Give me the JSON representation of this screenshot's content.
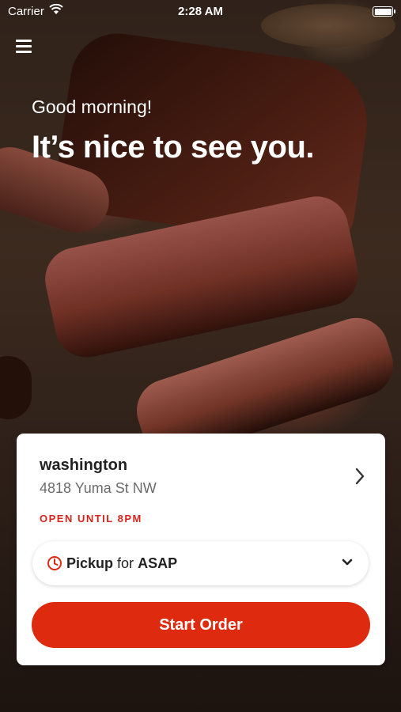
{
  "status_bar": {
    "carrier": "Carrier",
    "time": "2:28 AM"
  },
  "hero": {
    "greeting": "Good morning!",
    "headline": "It’s nice to see you."
  },
  "location": {
    "name": "washington",
    "address": "4818 Yuma St NW",
    "status": "OPEN UNTIL 8PM"
  },
  "order_mode": {
    "type": "Pickup",
    "connector": "for",
    "time": "ASAP"
  },
  "start_order_label": "Start Order",
  "colors": {
    "accent": "#de2a0f",
    "status_red": "#d9231b"
  },
  "icons": [
    "menu-icon",
    "wifi-icon",
    "battery-icon",
    "chevron-right-icon",
    "clock-icon",
    "chevron-down-icon"
  ]
}
